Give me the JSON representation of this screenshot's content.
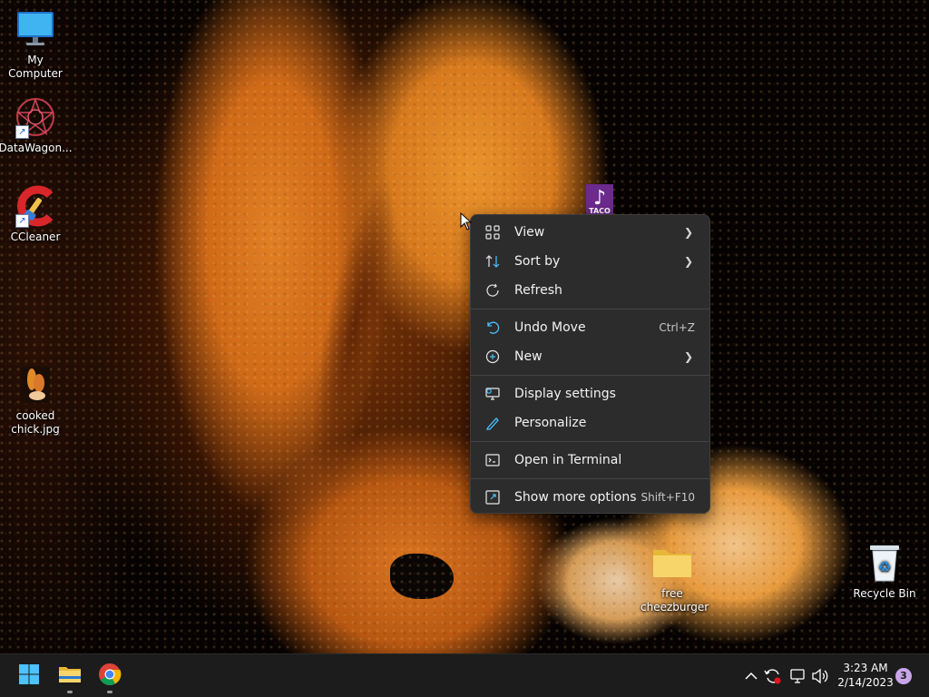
{
  "desktop": {
    "icons": [
      {
        "name": "my-computer",
        "label": "My Computer",
        "icon": "monitor-icon"
      },
      {
        "name": "datawagon",
        "label": "DataWagon...",
        "icon": "datawagon-logo-icon"
      },
      {
        "name": "ccleaner",
        "label": "CCleaner",
        "icon": "ccleaner-icon"
      },
      {
        "name": "cooked-chick",
        "label": "cooked chick.jpg",
        "icon": "image-file-icon"
      },
      {
        "name": "free-cheezburger",
        "label": "free cheezburger",
        "icon": "folder-icon"
      },
      {
        "name": "recycle-bin",
        "label": "Recycle Bin",
        "icon": "recycle-bin-icon"
      },
      {
        "name": "taco-bell",
        "label": "",
        "icon": "taco-bell-icon"
      }
    ],
    "taco_text": "TACO"
  },
  "context_menu": {
    "items": [
      {
        "label": "View",
        "icon": "grid-icon",
        "submenu": true,
        "shortcut": ""
      },
      {
        "label": "Sort by",
        "icon": "sort-icon",
        "submenu": true,
        "shortcut": ""
      },
      {
        "label": "Refresh",
        "icon": "refresh-icon",
        "submenu": false,
        "shortcut": ""
      },
      {
        "label": "Undo Move",
        "icon": "undo-icon",
        "submenu": false,
        "shortcut": "Ctrl+Z"
      },
      {
        "label": "New",
        "icon": "plus-circle-icon",
        "submenu": true,
        "shortcut": ""
      },
      {
        "label": "Display settings",
        "icon": "display-icon",
        "submenu": false,
        "shortcut": ""
      },
      {
        "label": "Personalize",
        "icon": "pen-icon",
        "submenu": false,
        "shortcut": ""
      },
      {
        "label": "Open in Terminal",
        "icon": "terminal-icon",
        "submenu": false,
        "shortcut": ""
      },
      {
        "label": "Show more options",
        "icon": "expand-icon",
        "submenu": false,
        "shortcut": "Shift+F10"
      }
    ]
  },
  "taskbar": {
    "pinned": [
      {
        "name": "start",
        "icon": "windows-logo-icon",
        "running": false
      },
      {
        "name": "file-explorer",
        "icon": "folder-icon",
        "running": true
      },
      {
        "name": "chrome",
        "icon": "chrome-icon",
        "running": true
      }
    ],
    "tray": {
      "icons": [
        "chevron-up-icon",
        "sync-icon",
        "network-icon",
        "volume-icon"
      ],
      "time": "3:23 AM",
      "date": "2/14/2023",
      "notification_count": "3"
    }
  },
  "colors": {
    "menu_bg": "#2c2c2c",
    "taskbar_bg": "#1c1c1c",
    "accent_blue": "#4cc2ff",
    "badge": "#c8a6e8"
  }
}
